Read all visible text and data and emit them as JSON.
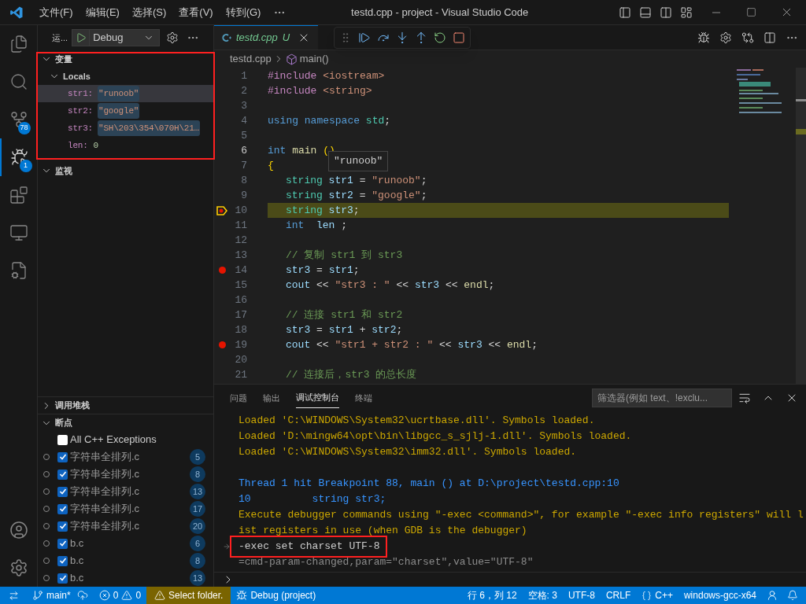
{
  "title_bar": {
    "menus": [
      "文件(F)",
      "编辑(E)",
      "选择(S)",
      "查看(V)",
      "转到(G)"
    ],
    "title": "testd.cpp - project - Visual Studio Code"
  },
  "activity_bar": [
    {
      "kind": "explorer",
      "selected": false
    },
    {
      "kind": "search",
      "selected": false
    },
    {
      "kind": "scm",
      "selected": false,
      "badge": "78"
    },
    {
      "kind": "debug",
      "selected": true,
      "badge": "1"
    },
    {
      "kind": "extensions",
      "selected": false
    },
    {
      "kind": "remote",
      "selected": false
    },
    {
      "kind": "testing",
      "selected": false
    }
  ],
  "sidebar": {
    "title": "运...",
    "launch_config": "Debug",
    "variables": {
      "title": "变量",
      "expanded": true,
      "scope": "Locals",
      "items": [
        {
          "name": "str1:",
          "value": "\"runoob\"",
          "changed": true,
          "selected": true
        },
        {
          "name": "str2:",
          "value": "\"google\"",
          "changed": true,
          "selected": false
        },
        {
          "name": "str3:",
          "value": "\"SH\\203\\354\\070H\\21…",
          "changed": true,
          "selected": false
        },
        {
          "name": "len:",
          "value": "0",
          "changed": false,
          "selected": false
        }
      ]
    },
    "watch": {
      "title": "监视",
      "expanded": true
    },
    "call_stack": {
      "title": "调用堆栈",
      "expanded": false
    },
    "breakpoints": {
      "title": "断点",
      "expanded": true,
      "exceptions": [
        {
          "label": "All C++ Exceptions",
          "checked": false
        }
      ],
      "items": [
        {
          "file": "字符串全排列.c",
          "line": "5",
          "checked": true
        },
        {
          "file": "字符串全排列.c",
          "line": "8",
          "checked": true
        },
        {
          "file": "字符串全排列.c",
          "line": "13",
          "checked": true
        },
        {
          "file": "字符串全排列.c",
          "line": "17",
          "checked": true
        },
        {
          "file": "字符串全排列.c",
          "line": "20",
          "checked": true
        },
        {
          "file": "b.c",
          "line": "6",
          "checked": true
        },
        {
          "file": "b.c",
          "line": "8",
          "checked": true
        },
        {
          "file": "b.c",
          "line": "13",
          "checked": true
        }
      ]
    }
  },
  "editor": {
    "tab": {
      "label": "testd.cpp",
      "status": "U",
      "selected": true
    },
    "breadcrumb": [
      "testd.cpp",
      "main()"
    ],
    "hover": "\"runoob\"",
    "lines": [
      {
        "number": "1",
        "indented": false,
        "breakpoint": false,
        "current": false,
        "cursor": false,
        "tokens": [
          {
            "text": "#include ",
            "kind": "macro"
          },
          {
            "text": "<iostream>",
            "kind": "string"
          }
        ]
      },
      {
        "number": "2",
        "indented": false,
        "breakpoint": false,
        "current": false,
        "cursor": false,
        "tokens": [
          {
            "text": "#include ",
            "kind": "macro"
          },
          {
            "text": "<string>",
            "kind": "string"
          }
        ]
      },
      {
        "number": "3",
        "breakpoint": false,
        "current": false,
        "cursor": false
      },
      {
        "number": "4",
        "indented": false,
        "breakpoint": false,
        "current": false,
        "cursor": false,
        "tokens": [
          {
            "text": "using namespace ",
            "kind": "keyword"
          },
          {
            "text": "std",
            "kind": "type"
          },
          {
            "text": ";",
            "kind": "plain"
          }
        ]
      },
      {
        "number": "5",
        "breakpoint": false,
        "current": false,
        "cursor": false
      },
      {
        "number": "6",
        "indented": false,
        "breakpoint": false,
        "current": false,
        "cursor": true,
        "tokens": [
          {
            "text": "int ",
            "kind": "keyword"
          },
          {
            "text": "main ",
            "kind": "function"
          },
          {
            "text": "()",
            "kind": "bracket"
          }
        ]
      },
      {
        "number": "7",
        "indented": false,
        "breakpoint": false,
        "current": false,
        "cursor": false,
        "tokens": [
          {
            "text": "{",
            "kind": "bracket"
          }
        ]
      },
      {
        "number": "8",
        "indented": true,
        "breakpoint": false,
        "current": false,
        "cursor": false,
        "tokens": [
          {
            "text": "string ",
            "kind": "type"
          },
          {
            "text": "str1",
            "kind": "variable"
          },
          {
            "text": " = ",
            "kind": "plain"
          },
          {
            "text": "\"runoob\"",
            "kind": "string"
          },
          {
            "text": ";",
            "kind": "plain"
          }
        ]
      },
      {
        "number": "9",
        "indented": true,
        "breakpoint": false,
        "current": false,
        "cursor": false,
        "tokens": [
          {
            "text": "string ",
            "kind": "type"
          },
          {
            "text": "str2",
            "kind": "variable"
          },
          {
            "text": " = ",
            "kind": "plain"
          },
          {
            "text": "\"google\"",
            "kind": "string"
          },
          {
            "text": ";",
            "kind": "plain"
          }
        ]
      },
      {
        "number": "10",
        "indented": true,
        "breakpoint": true,
        "current": true,
        "cursor": false,
        "tokens": [
          {
            "text": "string ",
            "kind": "type"
          },
          {
            "text": "str3",
            "kind": "variable"
          },
          {
            "text": ";",
            "kind": "plain"
          }
        ]
      },
      {
        "number": "11",
        "indented": true,
        "breakpoint": false,
        "current": false,
        "cursor": false,
        "tokens": [
          {
            "text": "int  ",
            "kind": "keyword"
          },
          {
            "text": "len",
            "kind": "variable"
          },
          {
            "text": " ;",
            "kind": "plain"
          }
        ]
      },
      {
        "number": "12",
        "breakpoint": false,
        "current": false,
        "cursor": false
      },
      {
        "number": "13",
        "indented": true,
        "breakpoint": false,
        "current": false,
        "cursor": false,
        "tokens": [
          {
            "text": "// 复制 str1 到 str3",
            "kind": "comment"
          }
        ]
      },
      {
        "number": "14",
        "indented": true,
        "breakpoint": true,
        "current": false,
        "cursor": false,
        "tokens": [
          {
            "text": "str3",
            "kind": "variable"
          },
          {
            "text": " = ",
            "kind": "plain"
          },
          {
            "text": "str1",
            "kind": "variable"
          },
          {
            "text": ";",
            "kind": "plain"
          }
        ]
      },
      {
        "number": "15",
        "indented": true,
        "breakpoint": false,
        "current": false,
        "cursor": false,
        "tokens": [
          {
            "text": "cout",
            "kind": "variable"
          },
          {
            "text": " << ",
            "kind": "plain"
          },
          {
            "text": "\"str3 : \"",
            "kind": "string"
          },
          {
            "text": " << ",
            "kind": "plain"
          },
          {
            "text": "str3",
            "kind": "variable"
          },
          {
            "text": " << ",
            "kind": "plain"
          },
          {
            "text": "endl",
            "kind": "function"
          },
          {
            "text": ";",
            "kind": "plain"
          }
        ]
      },
      {
        "number": "16",
        "breakpoint": false,
        "current": false,
        "cursor": false
      },
      {
        "number": "17",
        "indented": true,
        "breakpoint": false,
        "current": false,
        "cursor": false,
        "tokens": [
          {
            "text": "// 连接 str1 和 str2",
            "kind": "comment"
          }
        ]
      },
      {
        "number": "18",
        "indented": true,
        "breakpoint": false,
        "current": false,
        "cursor": false,
        "tokens": [
          {
            "text": "str3",
            "kind": "variable"
          },
          {
            "text": " = ",
            "kind": "plain"
          },
          {
            "text": "str1",
            "kind": "variable"
          },
          {
            "text": " + ",
            "kind": "plain"
          },
          {
            "text": "str2",
            "kind": "variable"
          },
          {
            "text": ";",
            "kind": "plain"
          }
        ]
      },
      {
        "number": "19",
        "indented": true,
        "breakpoint": true,
        "current": false,
        "cursor": false,
        "tokens": [
          {
            "text": "cout",
            "kind": "variable"
          },
          {
            "text": " << ",
            "kind": "plain"
          },
          {
            "text": "\"str1 + str2 : \"",
            "kind": "string"
          },
          {
            "text": " << ",
            "kind": "plain"
          },
          {
            "text": "str3",
            "kind": "variable"
          },
          {
            "text": " << ",
            "kind": "plain"
          },
          {
            "text": "endl",
            "kind": "function"
          },
          {
            "text": ";",
            "kind": "plain"
          }
        ]
      },
      {
        "number": "20",
        "breakpoint": false,
        "current": false,
        "cursor": false
      },
      {
        "number": "21",
        "indented": true,
        "breakpoint": false,
        "current": false,
        "cursor": false,
        "tokens": [
          {
            "text": "// 连接后，str3 的总长度",
            "kind": "comment"
          }
        ]
      }
    ]
  },
  "panel": {
    "tabs": [
      {
        "label": "问题",
        "selected": false
      },
      {
        "label": "输出",
        "selected": false
      },
      {
        "label": "调试控制台",
        "selected": true
      },
      {
        "label": "终端",
        "selected": false
      }
    ],
    "filter": {
      "placeholder": "筛选器(例如 text、!exclu..."
    },
    "console": [
      {
        "kind": "info",
        "text": "Loaded 'C:\\WINDOWS\\System32\\ucrtbase.dll'. Symbols loaded.",
        "spaced": false,
        "highlighted": false
      },
      {
        "kind": "info",
        "text": "Loaded 'D:\\mingw64\\opt\\bin\\libgcc_s_sjlj-1.dll'. Symbols loaded.",
        "spaced": false,
        "highlighted": false
      },
      {
        "kind": "info",
        "text": "Loaded 'C:\\WINDOWS\\System32\\imm32.dll'. Symbols loaded.",
        "spaced": false,
        "highlighted": false
      },
      {
        "kind": "event",
        "text": "Thread 1 hit Breakpoint 88, main () at D:\\project\\testd.cpp:10",
        "spaced": true,
        "highlighted": false
      },
      {
        "kind": "event",
        "text": "10          string str3;",
        "spaced": false,
        "highlighted": false
      },
      {
        "kind": "info",
        "text": "Execute debugger commands using \"-exec <command>\", for example \"-exec info registers\" will l",
        "spaced": false,
        "highlighted": false
      },
      {
        "kind": "info",
        "text": "ist registers in use (when GDB is the debugger)",
        "spaced": false,
        "highlighted": false
      },
      {
        "kind": "input",
        "text": "-exec set charset UTF-8",
        "spaced": false,
        "highlighted": true
      },
      {
        "kind": "output",
        "text": "=cmd-param-changed,param=\"charset\",value=\"UTF-8\"",
        "spaced": false,
        "highlighted": false
      }
    ]
  },
  "status_bar": {
    "branch": "main*",
    "errors": "0",
    "warnings": "0",
    "folder": "Select folder.",
    "debug": "Debug (project)",
    "cursor": "行 6，列 12",
    "indent": "空格: 3",
    "encoding": "UTF-8",
    "eol": "CRLF",
    "language": "C++",
    "config": "windows-gcc-x64"
  }
}
